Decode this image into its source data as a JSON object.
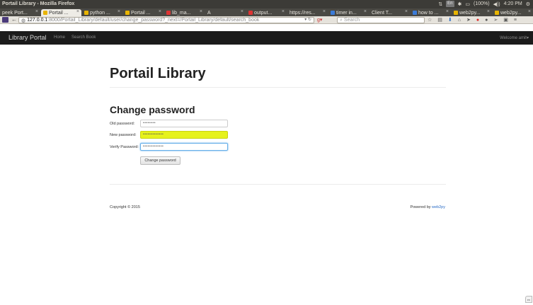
{
  "os": {
    "window_title": "Portail Library - Mozilla Firefox",
    "tray": {
      "lang": "En",
      "battery": "(100%)",
      "time": "4:20 PM"
    }
  },
  "browser": {
    "tabs": [
      {
        "label": "peek Port...",
        "active": false,
        "color": ""
      },
      {
        "label": "Portail ...",
        "active": true,
        "color": "#e8b400"
      },
      {
        "label": "python ...",
        "active": false,
        "color": "#e8b400"
      },
      {
        "label": "Portail ...",
        "active": false,
        "color": "#e8b400"
      },
      {
        "label": "lib_ma...",
        "active": false,
        "color": "#d33"
      },
      {
        "label": "A",
        "active": false,
        "color": ""
      },
      {
        "label": "output...",
        "active": false,
        "color": "#d33"
      },
      {
        "label": "https://res...",
        "active": false,
        "color": ""
      },
      {
        "label": "timer in...",
        "active": false,
        "color": "#3b7bd8"
      },
      {
        "label": "Client T...",
        "active": false,
        "color": ""
      },
      {
        "label": "how to ...",
        "active": false,
        "color": "#3b7bd8"
      },
      {
        "label": "web2py...",
        "active": false,
        "color": "#e8b400"
      },
      {
        "label": "web2py...",
        "active": false,
        "color": "#e8b400"
      }
    ],
    "url_host": "127.0.0.1",
    "url_path": ":8000/Portail_Library/default/user/change_password?_next=/Portail_Library/default/search_book",
    "search_placeholder": "Search"
  },
  "app": {
    "brand": "Library Portal",
    "nav": [
      "Home",
      "Search Book"
    ],
    "welcome": "Welcome amit"
  },
  "page": {
    "title": "Portail Library",
    "form_heading": "Change password",
    "fields": [
      {
        "label": "Old password:",
        "value": "••••••••"
      },
      {
        "label": "New password:",
        "value": "•••••••••••••"
      },
      {
        "label": "Verify Password:",
        "value": "•••••••••••••"
      }
    ],
    "submit_label": "Change password",
    "copyright": "Copyright © 2015",
    "powered_prefix": "Powered by",
    "powered_link": "web2py"
  },
  "colors": {
    "autofill_highlight": "#e6f21c",
    "app_bar": "#1b1b1b",
    "link": "#2a6cc6"
  }
}
